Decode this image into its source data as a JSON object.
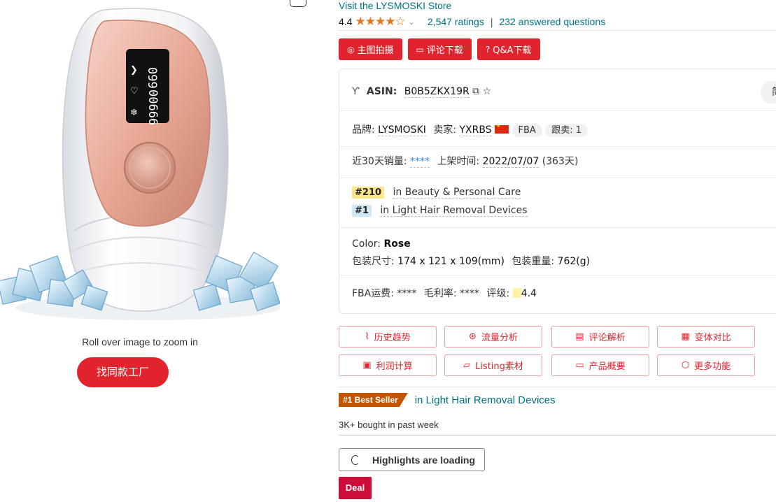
{
  "image_panel": {
    "zoom_hint": "Roll over image to zoom in",
    "find_factory_label": "找同款工厂",
    "device_display_left": "099",
    "device_display_right": "00666"
  },
  "store": {
    "link_label": "Visit the LYSMOSKI Store"
  },
  "rating": {
    "value": "4.4",
    "stars": 4.4,
    "star_glyphs": "★★★★☆",
    "ratings_label": "2,547 ratings",
    "separator": "|",
    "questions_label": "232 answered questions"
  },
  "toolbar": {
    "buttons": [
      {
        "icon": "◎",
        "label": "主图拍摄"
      },
      {
        "icon": "▭",
        "label": "评论下载"
      },
      {
        "icon": "?",
        "label": "Q&A下载"
      }
    ]
  },
  "info": {
    "asin_label": "ASIN:",
    "asin_value": "B0B5ZKX19R",
    "simp_label": "简",
    "brand_label": "品牌:",
    "brand_value": "LYSMOSKI",
    "seller_label": "卖家:",
    "seller_value": "YXRBS",
    "fba_label": "FBA",
    "follow_label": "跟卖: 1",
    "sales_label": "近30天销量:",
    "sales_value": "****",
    "listed_label": "上架时间:",
    "listed_value": "2022/07/07",
    "listed_days": "(363天)",
    "rank1_num": "#210",
    "rank1_cat": "in Beauty & Personal Care",
    "rank2_num": "#1",
    "rank2_cat": "in Light Hair Removal Devices",
    "color_label": "Color:",
    "color_value": "Rose",
    "size_label": "包装尺寸:",
    "size_value": "174 x 121 x 109(mm)",
    "weight_label": "包装重量:",
    "weight_value": "762(g)",
    "fba_fee_label": "FBA运费:",
    "fba_fee_value": "****",
    "margin_label": "毛利率:",
    "margin_value": "****",
    "grade_label": "评级:",
    "grade_value": "4.4"
  },
  "features": [
    {
      "icon": "⌇",
      "label": "历史趋势"
    },
    {
      "icon": "⊛",
      "label": "流量分析"
    },
    {
      "icon": "▤",
      "label": "评论解析"
    },
    {
      "icon": "▦",
      "label": "变体对比"
    },
    {
      "icon": "▣",
      "label": "利润计算"
    },
    {
      "icon": "▱",
      "label": "Listing素材"
    },
    {
      "icon": "▭",
      "label": "产品概要"
    },
    {
      "icon": "⬡",
      "label": "更多功能"
    }
  ],
  "bestseller": {
    "badge": "#1 Best Seller",
    "category": "in Light Hair Removal Devices"
  },
  "bought_label": "3K+ bought in past week",
  "highlights_label": "Highlights are loading",
  "deal_label": "Deal",
  "colors": {
    "accent_red": "#e1232d",
    "link": "#007185",
    "star": "#de7921",
    "bestseller": "#c45500",
    "deal": "#cc0c39"
  }
}
